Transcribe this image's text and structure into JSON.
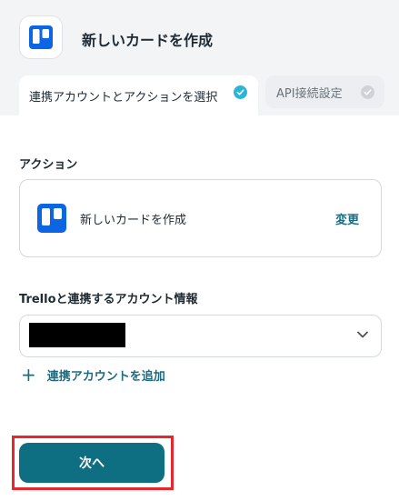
{
  "header": {
    "title": "新しいカードを作成",
    "app_icon": "trello-icon"
  },
  "tabs": [
    {
      "label": "連携アカウントとアクションを選択",
      "state": "completed",
      "active": true
    },
    {
      "label": "API接続設定",
      "state": "pending",
      "active": false
    }
  ],
  "action_section": {
    "label": "アクション",
    "card": {
      "icon": "trello-icon",
      "text": "新しいカードを作成",
      "change_label": "変更"
    }
  },
  "account_section": {
    "label": "Trelloと連携するアカウント情報",
    "selected_value_redacted": true,
    "add_account_label": "連携アカウントを追加"
  },
  "footer": {
    "next_label": "次へ"
  },
  "colors": {
    "accent": "#0f6f82",
    "link": "#1d6b80",
    "check_active": "#2cb5d3",
    "check_inactive": "#cfd3d8",
    "trello_blue": "#0c66e4",
    "highlight": "#e8262d"
  }
}
